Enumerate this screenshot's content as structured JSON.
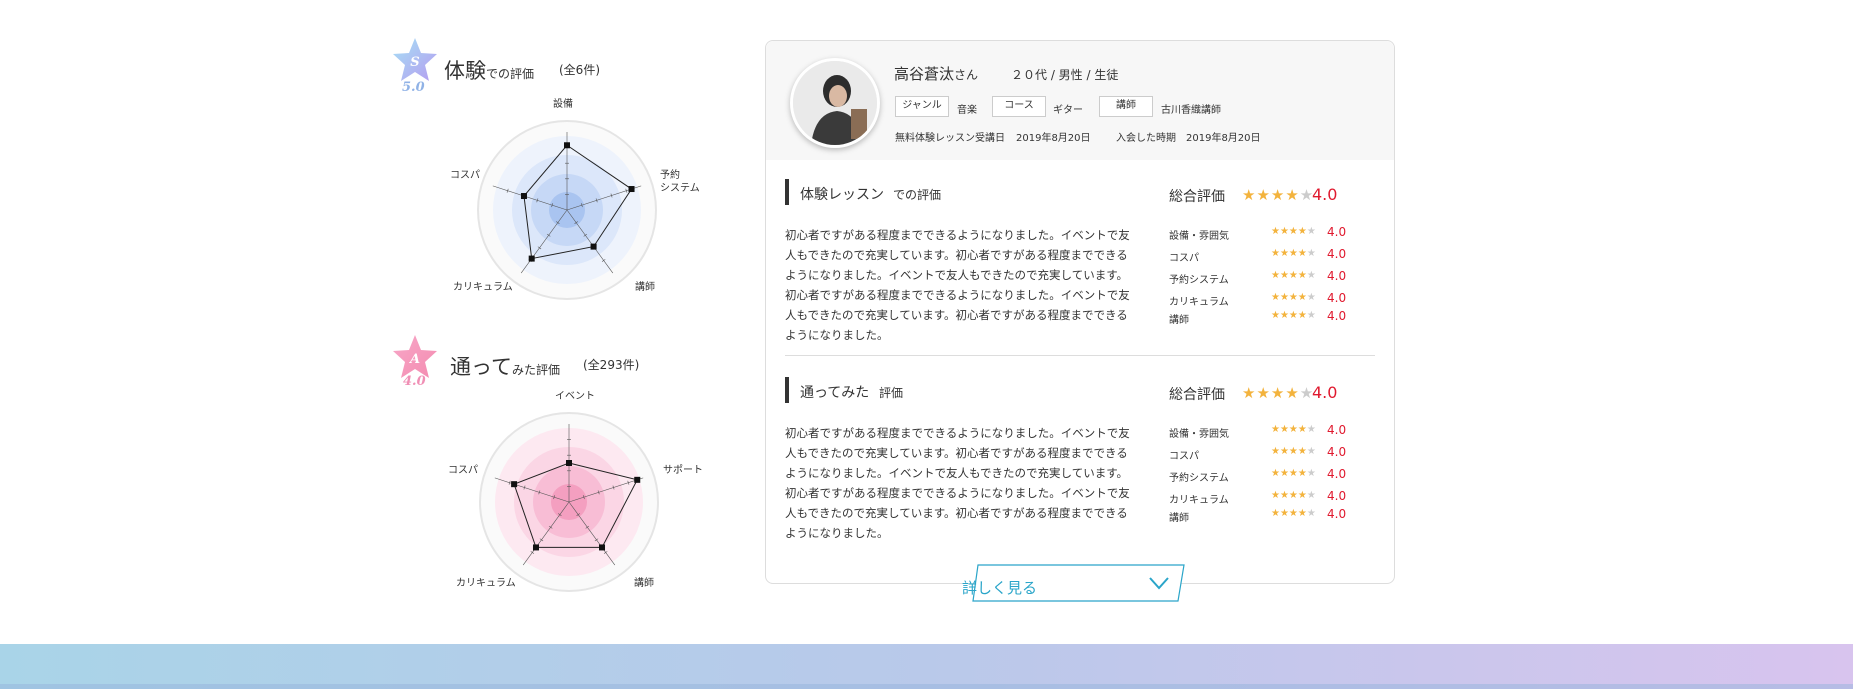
{
  "experience": {
    "grade_letter": "S",
    "grade_score": "5.0",
    "title_main": "体験",
    "title_sub": "での評価",
    "count": "(全6件)",
    "radar_labels": {
      "top": "設備",
      "right": "予約\nシステム",
      "bottom_right": "講師",
      "bottom_left": "カリキュラム",
      "left": "コスパ"
    },
    "radar_values": [
      0.83,
      0.87,
      0.58,
      0.77,
      0.58
    ],
    "accent_color": "#8fb4ea"
  },
  "attended": {
    "grade_letter": "A",
    "grade_score": "4.0",
    "title_main": "通って",
    "title_sub": "みた評価",
    "count": "(全293件)",
    "radar_labels": {
      "top": "イベント",
      "right": "サポート",
      "bottom_right": "講師",
      "bottom_left": "カリキュラム",
      "left": "コスパ"
    },
    "radar_values": [
      0.5,
      0.92,
      0.72,
      0.72,
      0.74
    ],
    "accent_color": "#f49fc0"
  },
  "profile": {
    "name": "高谷蒼汰",
    "honorific": "さん",
    "demographics": "２０代 / 男性 / 生徒",
    "genre_tag": "ジャンル",
    "genre_value": "音楽",
    "course_tag": "コース",
    "course_value": "ギター",
    "teacher_tag": "講師",
    "teacher_value": "古川香織講師",
    "trial_label": "無料体験レッスン受講日",
    "trial_date": "2019年8月20日",
    "join_label": "入会した時期",
    "join_date": "2019年8月20日"
  },
  "reviews": [
    {
      "title": "体験レッスン",
      "subtitle": "での評価",
      "text": "初心者ですがある程度までできるようになりました。イベントで友人もできたので充実しています。初心者ですがある程度までできるようになりました。イベントで友人もできたので充実しています。初心者ですがある程度までできるようになりました。イベントで友人もできたので充実しています。初心者ですがある程度までできるようになりました。",
      "total_label": "総合評価",
      "total_stars": 4,
      "total_score": "4.0",
      "criteria": [
        {
          "label": "設備・雰囲気",
          "stars": 4,
          "score": "4.0"
        },
        {
          "label": "コスパ",
          "stars": 4,
          "score": "4.0"
        },
        {
          "label": "予約システム",
          "stars": 4,
          "score": "4.0"
        },
        {
          "label": "カリキュラム",
          "stars": 4,
          "score": "4.0"
        },
        {
          "label": "講師",
          "stars": 4,
          "score": "4.0"
        }
      ]
    },
    {
      "title": "通ってみた",
      "subtitle": "評価",
      "text": "初心者ですがある程度までできるようになりました。イベントで友人もできたので充実しています。初心者ですがある程度までできるようになりました。イベントで友人もできたので充実しています。初心者ですがある程度までできるようになりました。イベントで友人もできたので充実しています。初心者ですがある程度までできるようになりました。",
      "total_label": "総合評価",
      "total_stars": 4,
      "total_score": "4.0",
      "criteria": [
        {
          "label": "設備・雰囲気",
          "stars": 4,
          "score": "4.0"
        },
        {
          "label": "コスパ",
          "stars": 4,
          "score": "4.0"
        },
        {
          "label": "予約システム",
          "stars": 4,
          "score": "4.0"
        },
        {
          "label": "カリキュラム",
          "stars": 4,
          "score": "4.0"
        },
        {
          "label": "講師",
          "stars": 4,
          "score": "4.0"
        }
      ]
    }
  ],
  "more_button": {
    "label": "詳しく見る",
    "icon": "chevron-down-icon"
  },
  "colors": {
    "star": "#f3b33d",
    "score": "#e0192e",
    "link": "#2aa5c9"
  }
}
